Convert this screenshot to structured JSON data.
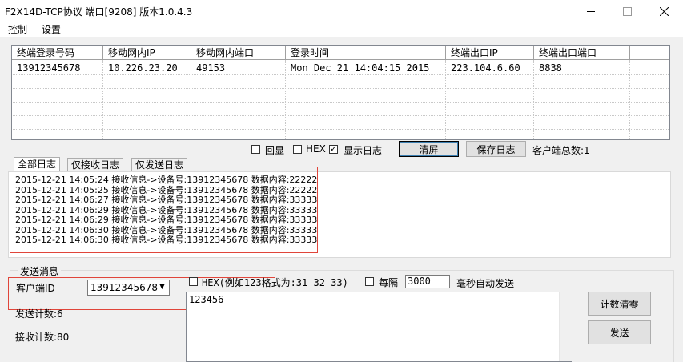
{
  "window": {
    "title": "F2X14D-TCP协议  端口[9208] 版本1.0.4.3"
  },
  "menu": [
    "控制",
    "设置"
  ],
  "clients_table": {
    "columns": [
      "终端登录号码",
      "移动网内IP",
      "移动网内端口",
      "登录时间",
      "终端出口IP",
      "终端出口端口"
    ],
    "rows": [
      [
        "13912345678",
        "10.226.23.20",
        "49153",
        "Mon Dec 21 14:04:15 2015",
        "223.104.6.60",
        "8838"
      ]
    ]
  },
  "options": {
    "echo_label": "回显",
    "echo_checked": false,
    "hex_label": "HEX",
    "hex_checked": false,
    "showlog_label": "显示日志",
    "showlog_checked": true,
    "clear_button": "清屏",
    "save_log_button": "保存日志",
    "client_total": "客户端总数:1"
  },
  "tabs": [
    "全部日志",
    "仅接收日志",
    "仅发送日志"
  ],
  "active_tab": 0,
  "log_lines": [
    "2015-12-21 14:05:24 接收信息->设备号:13912345678 数据内容:22222",
    "2015-12-21 14:05:25 接收信息->设备号:13912345678 数据内容:22222",
    "2015-12-21 14:06:27 接收信息->设备号:13912345678 数据内容:33333",
    "2015-12-21 14:06:29 接收信息->设备号:13912345678 数据内容:33333",
    "2015-12-21 14:06:29 接收信息->设备号:13912345678 数据内容:33333",
    "2015-12-21 14:06:30 接收信息->设备号:13912345678 数据内容:33333",
    "2015-12-21 14:06:30 接收信息->设备号:13912345678 数据内容:33333"
  ],
  "send": {
    "group_title": "发送消息",
    "client_id_label": "客户端ID",
    "client_id_value": "13912345678",
    "hex_label": "HEX(例如123格式为:31 32 33)",
    "hex_checked": false,
    "interval_label": "每隔",
    "interval_checked": false,
    "interval_value": "3000",
    "interval_unit": "毫秒自动发送",
    "send_count": "发送计数:6",
    "recv_count": "接收计数:80",
    "message": "123456",
    "reset_button": "计数清零",
    "send_button": "发送"
  },
  "colors": {
    "highlight_box": "#e0453a",
    "window_bg": "#f0f0f0",
    "button_bg": "#e1e1e1"
  }
}
